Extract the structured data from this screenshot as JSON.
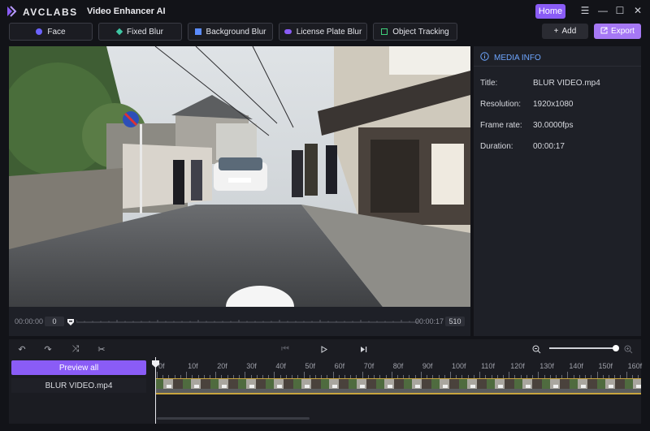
{
  "app": {
    "brand": "AVCLABS",
    "product": "Video Enhancer AI",
    "home_label": "Home"
  },
  "window_controls": {
    "menu": "☰",
    "minimize": "—",
    "maximize": "☐",
    "close": "✕"
  },
  "tools": [
    {
      "label": "Face",
      "icon": "face-icon",
      "color": "#6c63ff"
    },
    {
      "label": "Fixed Blur",
      "icon": "sparkle-icon",
      "color": "#3fc7a4"
    },
    {
      "label": "Background Blur",
      "icon": "background-icon",
      "color": "#5b8cff"
    },
    {
      "label": "License Plate Blur",
      "icon": "car-icon",
      "color": "#8a5cf6"
    },
    {
      "label": "Object Tracking",
      "icon": "target-icon",
      "color": "#3fd07a"
    }
  ],
  "actions": {
    "add_label": "Add",
    "export_label": "Export"
  },
  "scrubber": {
    "start_time": "00:00:00",
    "start_frame": "0",
    "end_time": "00:00:17",
    "end_frame": "510"
  },
  "media_info": {
    "heading": "MEDIA INFO",
    "rows": [
      {
        "label": "Title:",
        "value": "BLUR VIDEO.mp4"
      },
      {
        "label": "Resolution:",
        "value": "1920x1080"
      },
      {
        "label": "Frame rate:",
        "value": "30.0000fps"
      },
      {
        "label": "Duration:",
        "value": "00:00:17"
      }
    ]
  },
  "timeline": {
    "preview_all_label": "Preview all",
    "track_name": "BLUR VIDEO.mp4",
    "ruler": [
      "0f",
      "10f",
      "20f",
      "30f",
      "40f",
      "50f",
      "60f",
      "70f",
      "80f",
      "90f",
      "100f",
      "110f",
      "120f",
      "130f",
      "140f",
      "150f",
      "160f"
    ],
    "zoom_level": 1.0
  },
  "colors": {
    "accent": "#8a5cf6",
    "export": "#a678f5",
    "info_heading": "#6ea6ff",
    "track_border": "#c8a43e"
  }
}
